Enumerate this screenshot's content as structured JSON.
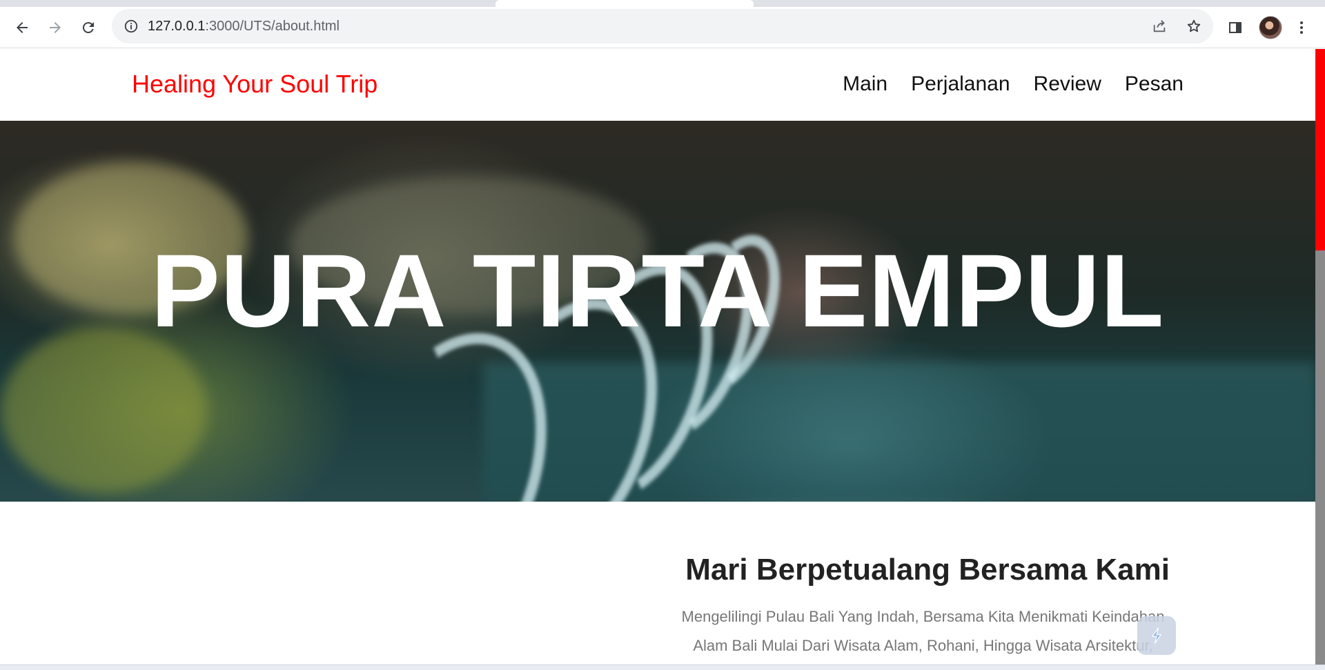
{
  "browser": {
    "url_host": "127.0.0.1",
    "url_path": ":3000/UTS/about.html",
    "icons": [
      "back-arrow-icon",
      "forward-arrow-icon",
      "reload-icon",
      "info-icon",
      "share-icon",
      "star-icon",
      "side-panel-icon",
      "menu-dots-icon"
    ]
  },
  "site": {
    "brand": "Healing Your Soul Trip",
    "nav": [
      "Main",
      "Perjalanan",
      "Review",
      "Pesan"
    ]
  },
  "hero": {
    "title": "PURA TIRTA EMPUL"
  },
  "about": {
    "title": "Mari Berpetualang Bersama Kami",
    "text": "Mengelilingi Pulau Bali Yang Indah, Bersama Kita Menikmati Keindahan Alam Bali Mulai Dari Wisata Alam, Rohani, Hingga Wisata Arsitektur,"
  },
  "colors": {
    "brand": "#ff0000",
    "scroll_accent": "#ff0000"
  }
}
